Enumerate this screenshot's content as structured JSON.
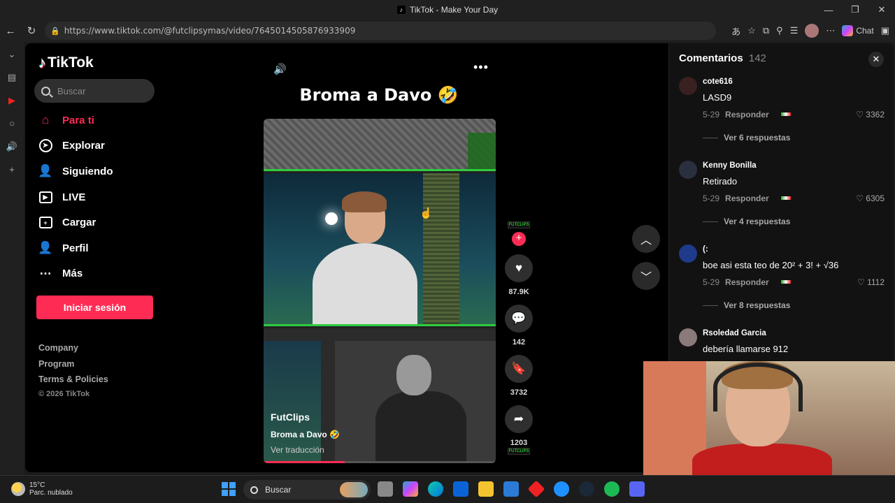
{
  "window": {
    "title": "TikTok - Make Your Day"
  },
  "browser": {
    "url": "https://www.tiktok.com/@futclipsymas/video/7645014505876933909",
    "chat_label": "Chat"
  },
  "sidebar": {
    "logo_text": "TikTok",
    "search_placeholder": "Buscar",
    "items": [
      {
        "label": "Para ti",
        "icon": "home-icon",
        "active": true
      },
      {
        "label": "Explorar",
        "icon": "compass-icon"
      },
      {
        "label": "Siguiendo",
        "icon": "following-icon"
      },
      {
        "label": "LIVE",
        "icon": "live-icon"
      },
      {
        "label": "Cargar",
        "icon": "upload-icon"
      },
      {
        "label": "Perfil",
        "icon": "profile-icon"
      },
      {
        "label": "Más",
        "icon": "more-icon"
      }
    ],
    "login_label": "Iniciar sesión",
    "footer": [
      "Company",
      "Program",
      "Terms & Policies"
    ],
    "copyright": "© 2026 TikTok"
  },
  "video": {
    "title": "Broma a Davo 🤣",
    "author": "FutClips",
    "description": "Broma a Davo 🤣",
    "translate_label": "Ver traducción",
    "creator_badge": "FUTCLIPS",
    "likes": "87.9K",
    "comments": "142",
    "saves": "3732",
    "shares": "1203",
    "progress": 0.35
  },
  "comments_panel": {
    "title": "Comentarios",
    "count": "142",
    "items": [
      {
        "user": "cote616",
        "text": "LASD9",
        "date": "5-29",
        "reply": "Responder",
        "likes": "3362",
        "more": "Ver 6 respuestas"
      },
      {
        "user": "Kenny Bonilla",
        "text": "Retirado",
        "date": "5-29",
        "reply": "Responder",
        "likes": "6305",
        "more": "Ver 4 respuestas"
      },
      {
        "user": "(:",
        "text": "boe asi esta teo de 20² + 3! + √36",
        "date": "5-29",
        "reply": "Responder",
        "likes": "1112",
        "more": "Ver 8 respuestas"
      },
      {
        "user": "Rsoledad Garcia",
        "text": "debería llamarse 912"
      }
    ]
  },
  "taskbar": {
    "temperature": "15°C",
    "weather": "Parc. nublado",
    "search_label": "Buscar"
  },
  "colors": {
    "accent": "#fe2c55",
    "bg": "#000000"
  }
}
